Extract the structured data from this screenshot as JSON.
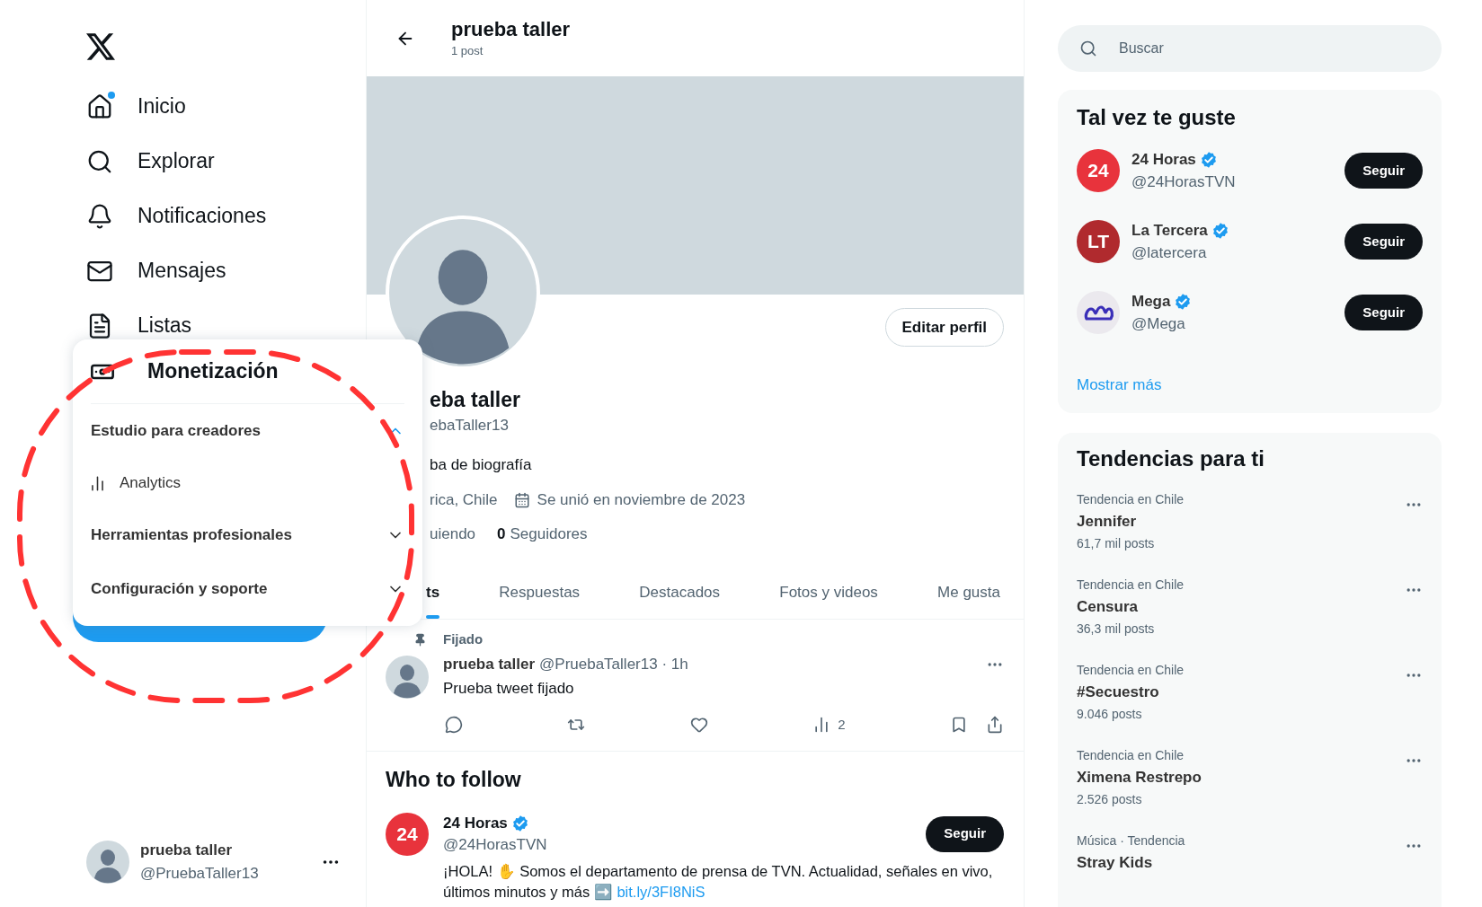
{
  "sidebar": {
    "nav": [
      {
        "label": "Inicio",
        "dot": true
      },
      {
        "label": "Explorar",
        "dot": false
      },
      {
        "label": "Notificaciones",
        "dot": false
      },
      {
        "label": "Mensajes",
        "dot": false
      },
      {
        "label": "Listas",
        "dot": false
      }
    ],
    "account": {
      "name": "prueba taller",
      "handle": "@PruebaTaller13"
    }
  },
  "menu": {
    "title": "Monetización",
    "sections": [
      {
        "label": "Estudio para creadores",
        "expanded": true,
        "children": [
          {
            "label": "Analytics"
          }
        ]
      },
      {
        "label": "Herramientas profesionales",
        "expanded": false
      },
      {
        "label": "Configuración y soporte",
        "expanded": false
      }
    ]
  },
  "header": {
    "title": "prueba taller",
    "subtitle": "1 post"
  },
  "profile": {
    "edit_button": "Editar perfil",
    "name": "eba taller",
    "handle": "ebaTaller13",
    "bio": "ba de biografía",
    "location": "rica, Chile",
    "joined": "Se unió en noviembre de 2023",
    "following_label": "uiendo",
    "followers_count": "0",
    "followers_label": "Seguidores"
  },
  "tabs": [
    {
      "label": "ts",
      "selected": true
    },
    {
      "label": "Respuestas",
      "selected": false
    },
    {
      "label": "Destacados",
      "selected": false
    },
    {
      "label": "Fotos y videos",
      "selected": false
    },
    {
      "label": "Me gusta",
      "selected": false
    }
  ],
  "pinned_post": {
    "pin_label": "Fijado",
    "name": "prueba taller",
    "meta": "@PruebaTaller13 · 1h",
    "text": "Prueba tweet fijado",
    "views": "2"
  },
  "who_to_follow": {
    "title": "Who to follow",
    "users": [
      {
        "name": "24 Horas",
        "handle": "@24HorasTVN",
        "verified": true,
        "avatar": {
          "kind": "text",
          "text": "24",
          "color": "#e8333c"
        },
        "button": "Seguir",
        "bio": "¡HOLA! ✋ Somos el departamento de prensa de TVN. Actualidad, señales en vivo, últimos minutos y más ➡️",
        "link": "bit.ly/3FI8NiS"
      }
    ]
  },
  "search": {
    "placeholder": "Buscar"
  },
  "suggestions": {
    "title": "Tal vez te guste",
    "more_link": "Mostrar más",
    "users": [
      {
        "name": "24 Horas",
        "handle": "@24HorasTVN",
        "verified": true,
        "avatar": {
          "kind": "text",
          "text": "24",
          "color": "#e8333c"
        },
        "button": "Seguir"
      },
      {
        "name": "La Tercera",
        "handle": "@latercera",
        "verified": true,
        "avatar": {
          "kind": "text",
          "text": "LT",
          "color": "#b02a2e"
        },
        "button": "Seguir"
      },
      {
        "name": "Mega",
        "handle": "@Mega",
        "verified": true,
        "avatar": {
          "kind": "logo"
        },
        "button": "Seguir"
      }
    ]
  },
  "trends": {
    "title": "Tendencias para ti",
    "items": [
      {
        "context": "Tendencia en Chile",
        "name": "Jennifer",
        "count": "61,7 mil posts"
      },
      {
        "context": "Tendencia en Chile",
        "name": "Censura",
        "count": "36,3 mil posts"
      },
      {
        "context": "Tendencia en Chile",
        "name": "#Secuestro",
        "count": "9.046 posts"
      },
      {
        "context": "Tendencia en Chile",
        "name": "Ximena Restrepo",
        "count": "2.526 posts"
      },
      {
        "context": "Música · Tendencia",
        "name": "Stray Kids"
      }
    ]
  }
}
